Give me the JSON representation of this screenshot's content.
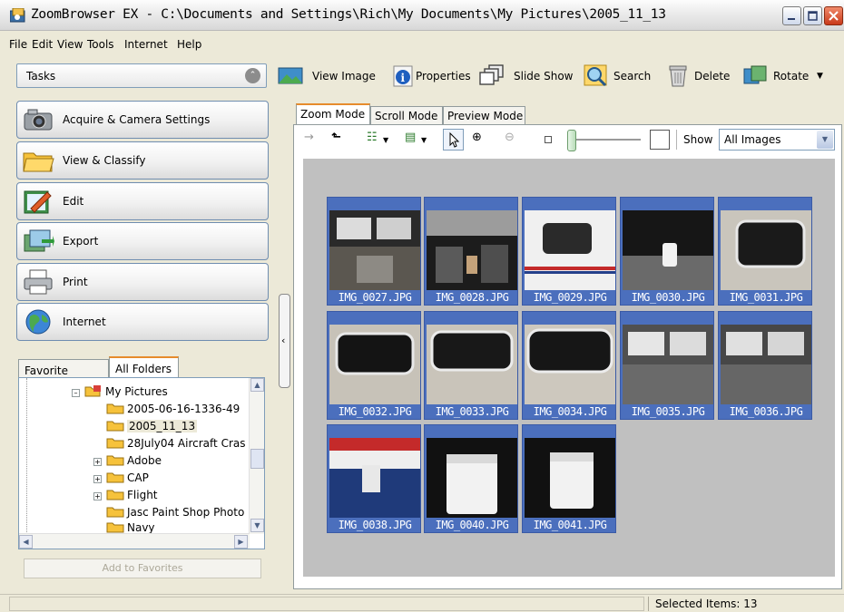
{
  "window": {
    "title": "ZoomBrowser EX  -  C:\\Documents and Settings\\Rich\\My Documents\\My Pictures\\2005_11_13"
  },
  "menu": [
    "File",
    "Edit",
    "View",
    "Tools",
    "Internet",
    "Help"
  ],
  "tasks": {
    "header": "Tasks",
    "items": [
      {
        "label": "Acquire & Camera Settings",
        "icon": "camera-icon"
      },
      {
        "label": "View & Classify",
        "icon": "folder-icon"
      },
      {
        "label": "Edit",
        "icon": "edit-icon"
      },
      {
        "label": "Export",
        "icon": "export-icon"
      },
      {
        "label": "Print",
        "icon": "printer-icon"
      },
      {
        "label": "Internet",
        "icon": "globe-icon"
      }
    ]
  },
  "folders": {
    "tabs": [
      "Favorite Folders",
      "All Folders"
    ],
    "active_tab": "All Folders",
    "tree": [
      {
        "label": "My Pictures",
        "expanded": true
      },
      {
        "label": "2005-06-16-1336-49"
      },
      {
        "label": "2005_11_13",
        "selected": true
      },
      {
        "label": "28July04 Aircraft Cras"
      },
      {
        "label": "Adobe",
        "expandable": true
      },
      {
        "label": "CAP",
        "expandable": true
      },
      {
        "label": "Flight",
        "expandable": true
      },
      {
        "label": "Jasc Paint Shop Photo"
      },
      {
        "label": "Navy"
      }
    ],
    "add_button": "Add to Favorites"
  },
  "toolbar": [
    {
      "label": "View Image",
      "icon": "view-image-icon"
    },
    {
      "label": "Properties",
      "icon": "info-icon"
    },
    {
      "label": "Slide Show",
      "icon": "slideshow-icon"
    },
    {
      "label": "Search",
      "icon": "search-icon"
    },
    {
      "label": "Delete",
      "icon": "trash-icon"
    },
    {
      "label": "Rotate",
      "icon": "rotate-icon"
    }
  ],
  "modes": [
    "Zoom Mode",
    "Scroll Mode",
    "Preview Mode"
  ],
  "active_mode": "Zoom Mode",
  "viewer_toolbar": {
    "show_label": "Show",
    "show_value": "All Images"
  },
  "images": [
    "IMG_0027.JPG",
    "IMG_0028.JPG",
    "IMG_0029.JPG",
    "IMG_0030.JPG",
    "IMG_0031.JPG",
    "IMG_0032.JPG",
    "IMG_0033.JPG",
    "IMG_0034.JPG",
    "IMG_0035.JPG",
    "IMG_0036.JPG",
    "IMG_0038.JPG",
    "IMG_0040.JPG",
    "IMG_0041.JPG"
  ],
  "status": {
    "selected": "Selected Items: 13"
  },
  "colors": {
    "selection": "#4b6fbd",
    "tab_accent": "#e68b2c"
  }
}
